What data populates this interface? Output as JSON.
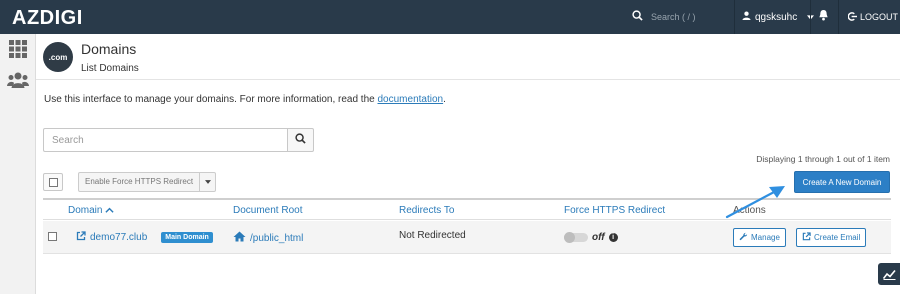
{
  "topbar": {
    "brand": "AZDIGI",
    "search_placeholder": "Search ( / )",
    "username": "qgsksuhc",
    "logout_label": "LOGOUT",
    "icons": [
      "search-icon",
      "user-icon",
      "caret-down-icon",
      "bell-icon",
      "logout-icon"
    ]
  },
  "sidebar": {
    "items": [
      {
        "icon": "grid-icon"
      },
      {
        "icon": "users-icon"
      }
    ]
  },
  "header": {
    "logo_text": ".com",
    "title": "Domains",
    "subtitle": "List Domains"
  },
  "intro": {
    "text": "Use this interface to manage your domains. For more information, read the ",
    "link": "documentation",
    "suffix": "."
  },
  "search": {
    "placeholder": "Search"
  },
  "displaying": "Displaying 1 through 1 out of 1 item",
  "bulk_action": {
    "label": "Enable Force HTTPS Redirect"
  },
  "create_button": "Create A New Domain",
  "table": {
    "headers": {
      "domain": "Domain",
      "document_root": "Document Root",
      "redirects_to": "Redirects To",
      "force_https": "Force HTTPS Redirect",
      "actions": "Actions"
    },
    "rows": [
      {
        "domain": "demo77.club",
        "badge": "Main Domain",
        "document_root": "/public_html",
        "redirects_to": "Not Redirected",
        "force_https": "off",
        "manage_label": "Manage",
        "create_email_label": "Create Email"
      }
    ]
  },
  "colors": {
    "topbar": "#293a4a",
    "accent": "#2b7bb9",
    "primary_button": "#2c7fc6"
  }
}
